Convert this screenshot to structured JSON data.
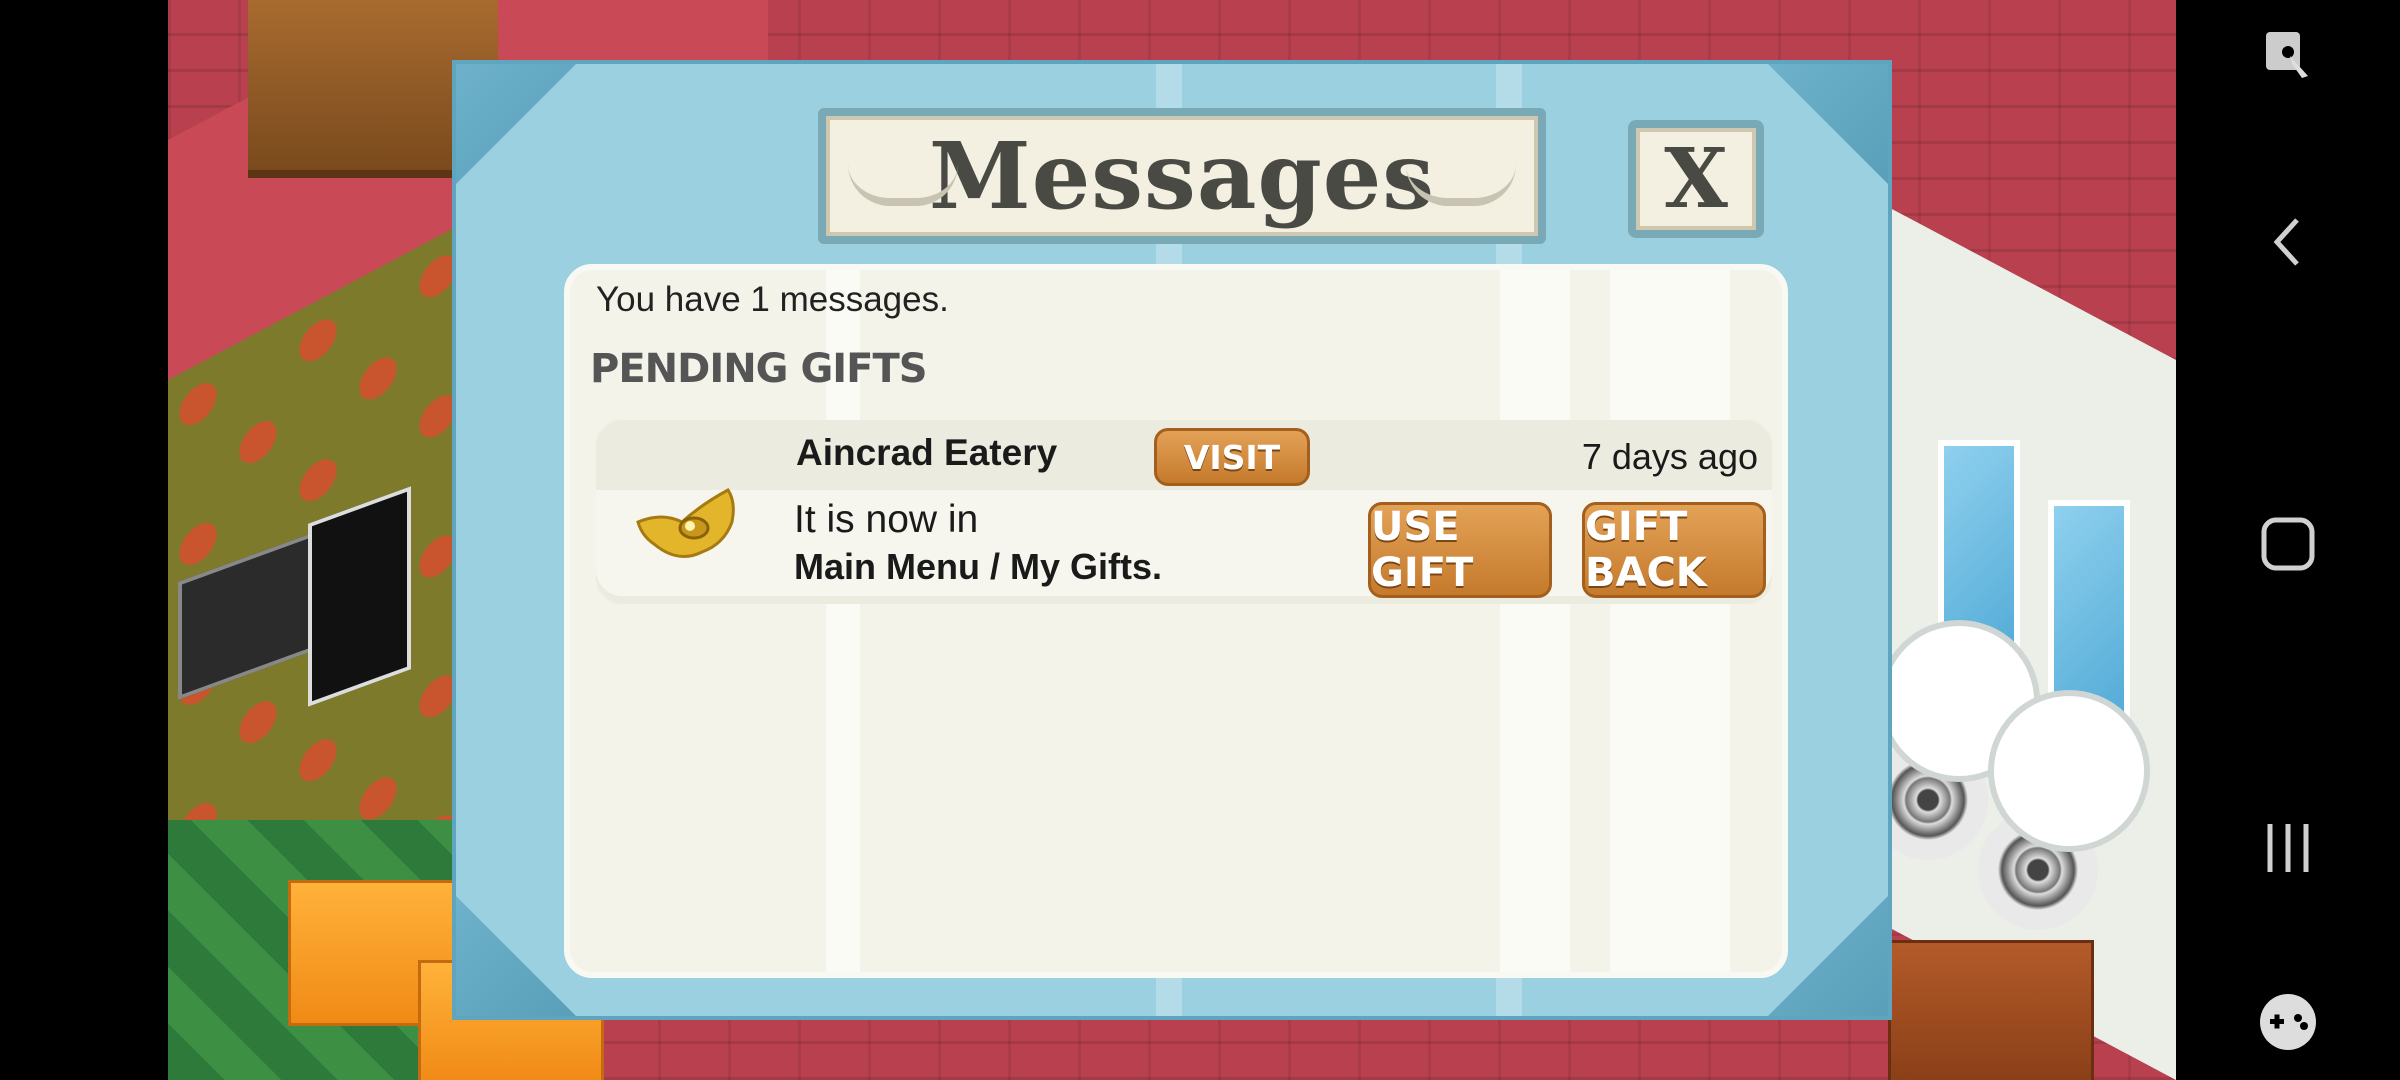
{
  "dialog": {
    "title": "Messages",
    "close_label": "X",
    "message_count_text": "You have 1 messages.",
    "section_title": "PENDING GIFTS",
    "gift": {
      "sender": "Aincrad Eatery",
      "visit_label": "VISIT",
      "time_ago": "7 days ago",
      "line1": "It is now in",
      "line2": "Main Menu / My Gifts.",
      "use_label": "USE GIFT",
      "back_label": "GIFT BACK",
      "icon": "golden-wing-nut-icon"
    }
  },
  "navbar": {
    "icons": [
      "screen-touch-icon",
      "back-icon",
      "home-icon",
      "recent-apps-icon",
      "game-controller-icon"
    ]
  },
  "colors": {
    "dialog_frame": "#9bd0e0",
    "panel": "#f4f3ea",
    "button_orange": "#d48b3d"
  }
}
